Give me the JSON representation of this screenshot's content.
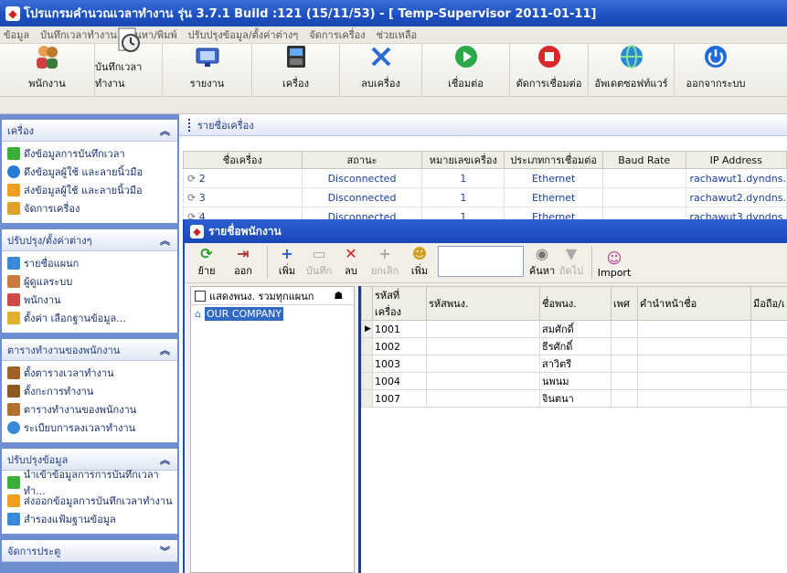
{
  "window": {
    "title": "โปรแกรมคำนวณเวลาทำงาน รุ่น 3.7.1 Build :121 (15/11/53) - [ Temp-Supervisor 2011-01-11]"
  },
  "menu": [
    "ข้อมูล",
    "บันทึกเวลาทำงาน",
    "ค้นหา/พิมพ์",
    "ปรับปรุงข้อมูล/ตั้งค่าต่างๆ",
    "จัดการเครื่อง",
    "ช่วยเหลือ"
  ],
  "toolbar": [
    {
      "label": "พนักงาน",
      "icon": "employees-icon"
    },
    {
      "label": "บันทึกเวลาทำงาน",
      "icon": "clock-icon"
    },
    {
      "label": "รายงาน",
      "icon": "report-icon"
    },
    {
      "label": "เครื่อง",
      "icon": "device-icon"
    },
    {
      "label": "ลบเครื่อง",
      "icon": "delete-x-icon"
    },
    {
      "label": "เชื่อมต่อ",
      "icon": "play-icon"
    },
    {
      "label": "ตัดการเชื่อมต่อ",
      "icon": "stop-icon"
    },
    {
      "label": "อัพเดตซอฟท์แวร์",
      "icon": "globe-icon"
    },
    {
      "label": "ออกจากระบบ",
      "icon": "power-icon"
    }
  ],
  "sidebar": {
    "groups": [
      {
        "title": "เครื่อง",
        "items": [
          "ดึงข้อมูลการบันทึกเวลา",
          "ดึงข้อมูลผู้ใช้ และลายนิ้วมือ",
          "ส่งข้อมูลผู้ใช้ และลายนิ้วมือ",
          "จัดการเครื่อง"
        ]
      },
      {
        "title": "ปรับปรุง/ตั้งค่าต่างๆ",
        "items": [
          "รายชื่อแผนก",
          "ผู้ดูแลระบบ",
          "พนักงาน",
          "ตั้งค่า เลือกฐานข้อมูล..."
        ]
      },
      {
        "title": "ตารางทำงานของพนักงาน",
        "items": [
          "ตั้งตารางเวลาทำงาน",
          "ตั้งกะการทำงาน",
          "ตารางทำงานของพนักงาน",
          "ระเบียบการลงเวลาทำงาน"
        ]
      },
      {
        "title": "ปรับปรุงข้อมูล",
        "items": [
          "นำเข้าข้อมูลการการบันทึกเวลาทำ...",
          "ส่งออกข้อมูลการบันทึกเวลาทำงาน",
          "สำรองแฟ้มฐานข้อมูล"
        ]
      },
      {
        "title": "จัดการประตู",
        "items": []
      }
    ]
  },
  "devices": {
    "heading": "รายชื่อเครื่อง",
    "columns": [
      "ชื่อเครื่อง",
      "สถานะ",
      "หมายเลขเครื่อง",
      "ประเภทการเชื่อมต่อ",
      "Baud Rate",
      "IP Address"
    ],
    "rows": [
      {
        "name": "2",
        "status": "Disconnected",
        "number": "1",
        "conn": "Ethernet",
        "baud": "",
        "ip": "rachawut1.dyndns."
      },
      {
        "name": "3",
        "status": "Disconnected",
        "number": "1",
        "conn": "Ethernet",
        "baud": "",
        "ip": "rachawut2.dyndns."
      },
      {
        "name": "4",
        "status": "Disconnected",
        "number": "1",
        "conn": "Ethernet",
        "baud": "",
        "ip": "rachawut3.dyndns."
      }
    ]
  },
  "employees": {
    "title": "รายชื่อพนักงาน",
    "tools": [
      {
        "label": "ย้าย",
        "glyph": "⟳",
        "color": "#2a9a2a"
      },
      {
        "label": "ออก",
        "glyph": "⇥",
        "color": "#b03030"
      },
      {
        "label": "เพิ่ม",
        "glyph": "+",
        "color": "#1f5fd0"
      },
      {
        "label": "บันทึก",
        "glyph": "▭",
        "color": "#aaaaaa",
        "disabled": true
      },
      {
        "label": "ลบ",
        "glyph": "✕",
        "color": "#d02020"
      },
      {
        "label": "ยกเลิก",
        "glyph": "+",
        "color": "#aaaaaa",
        "disabled": true
      },
      {
        "label": "เพิ่ม",
        "glyph": "☻",
        "color": "#d0a020"
      },
      {
        "label": "ค้นหา",
        "glyph": "◉",
        "color": "#777777"
      },
      {
        "label": "ถัดไป",
        "glyph": "▼",
        "color": "#aaaaaa",
        "disabled": true
      },
      {
        "label": "Import",
        "glyph": "☺",
        "color": "#c03090"
      }
    ],
    "tree_header": "แสดงพนง. รวมทุกแผนก",
    "tree_node": "OUR COMPANY",
    "columns": [
      "รหัสที่เครื่อง",
      "รหัสพนง.",
      "ชื่อพนง.",
      "เพศ",
      "คำนำหน้าชื่อ",
      "มือถือ/เ"
    ],
    "rows": [
      {
        "id": "1001",
        "code": "",
        "name": "สมศักดิ์",
        "sex": "",
        "prefix": "",
        "mobile": ""
      },
      {
        "id": "1002",
        "code": "",
        "name": "ธีรศักดิ์",
        "sex": "",
        "prefix": "",
        "mobile": ""
      },
      {
        "id": "1003",
        "code": "",
        "name": "สาวิตรี",
        "sex": "",
        "prefix": "",
        "mobile": ""
      },
      {
        "id": "1004",
        "code": "",
        "name": "นพนม",
        "sex": "",
        "prefix": "",
        "mobile": ""
      },
      {
        "id": "1007",
        "code": "",
        "name": "จินตนา",
        "sex": "",
        "prefix": "",
        "mobile": ""
      }
    ]
  }
}
